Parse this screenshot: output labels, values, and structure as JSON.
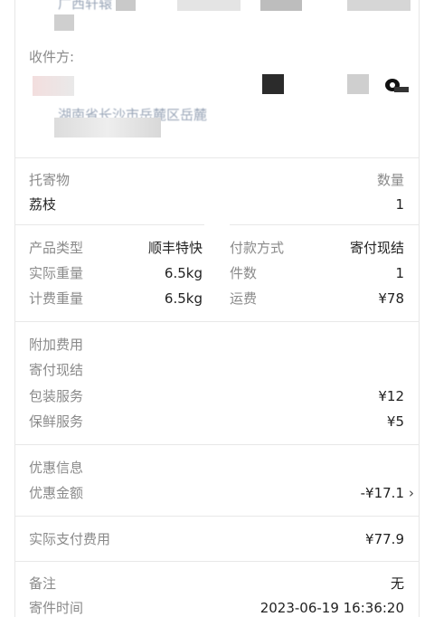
{
  "sender": {
    "address_fragment": "广西轩辕"
  },
  "recipient": {
    "label": "收件方:",
    "address": "湖南省长沙市岳麓区岳麓"
  },
  "goods": {
    "header_left": "托寄物",
    "header_right": "数量",
    "item_name": "荔枝",
    "item_qty": "1"
  },
  "details": {
    "left": [
      {
        "label": "产品类型",
        "value": "顺丰特快"
      },
      {
        "label": "实际重量",
        "value": "6.5kg"
      },
      {
        "label": "计费重量",
        "value": "6.5kg"
      }
    ],
    "right": [
      {
        "label": "付款方式",
        "value": "寄付现结"
      },
      {
        "label": "件数",
        "value": "1"
      },
      {
        "label": "运费",
        "value": "¥78"
      }
    ]
  },
  "extra": {
    "title": "附加费用",
    "payment_note": "寄付现结",
    "items": [
      {
        "label": "包装服务",
        "value": "¥12"
      },
      {
        "label": "保鲜服务",
        "value": "¥5"
      }
    ]
  },
  "discount": {
    "title": "优惠信息",
    "label": "优惠金额",
    "value": "-¥17.1"
  },
  "actual": {
    "label": "实际支付费用",
    "value": "¥77.9"
  },
  "notes": {
    "remark_label": "备注",
    "remark_value": "无",
    "time_label": "寄件时间",
    "time_value": "2023-06-19 16:36:20"
  }
}
